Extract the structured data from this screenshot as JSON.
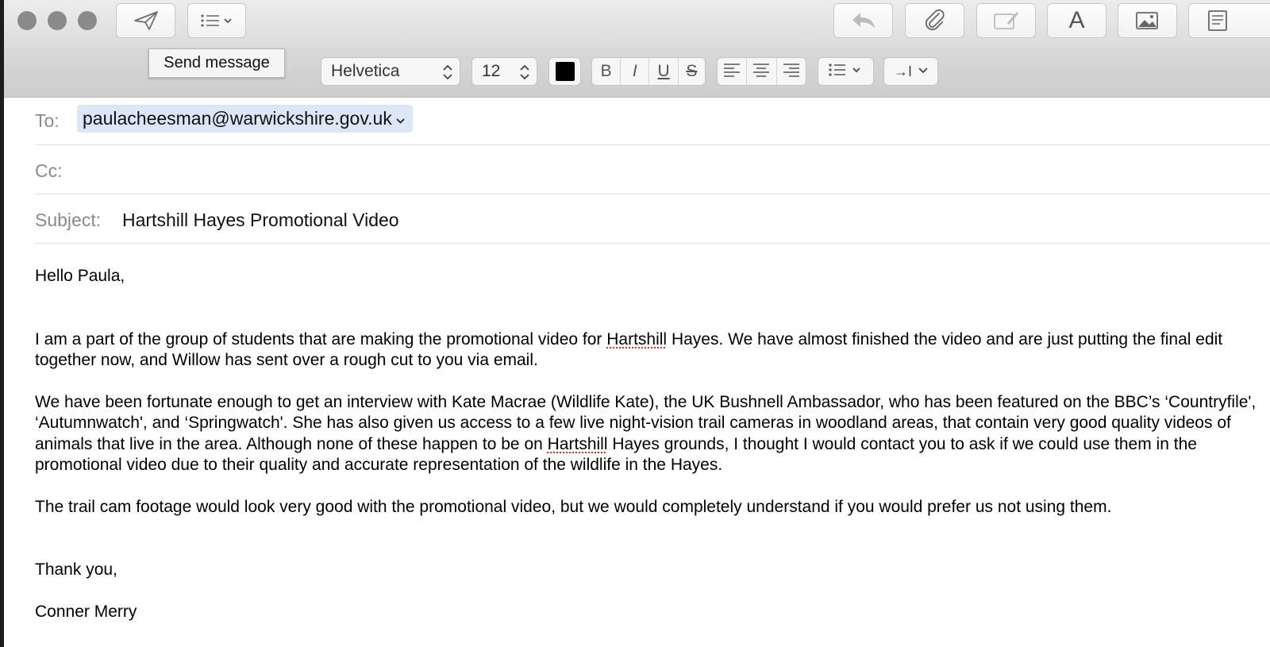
{
  "window": {
    "traffic_lights": [
      "close",
      "minimize",
      "zoom"
    ]
  },
  "toolbar": {
    "send_icon": "paper-plane-icon",
    "header_fields_icon": "list-chevron-icon",
    "reply_icon": "reply-arrow-icon",
    "attach_icon": "paperclip-icon",
    "annotate_icon": "markup-icon",
    "format_icon": "format-text-icon",
    "photo_icon": "photo-browser-icon",
    "stationery_icon": "stationery-icon",
    "format_glyph": "A"
  },
  "tooltip": {
    "text": "Send message"
  },
  "formatbar": {
    "font_family": "Helvetica",
    "font_size": "12",
    "text_color": "#000000",
    "bold": "B",
    "italic": "I",
    "underline": "U",
    "strike": "S",
    "align_icons": [
      "align-left-icon",
      "align-center-icon",
      "align-right-icon"
    ],
    "list_icon": "bullet-list-icon",
    "indent_glyph": "→I"
  },
  "headers": {
    "to_label": "To:",
    "to_value": "paulacheesman@warwickshire.gov.uk",
    "cc_label": "Cc:",
    "subject_label": "Subject:",
    "subject_value": "Hartshill Hayes Promotional Video"
  },
  "body": {
    "greeting": "Hello Paula,",
    "p1_a": "I am a part of the group of students that are making the promotional video for ",
    "p1_word": "Hartshill",
    "p1_b": " Hayes. We have almost finished the video and are just putting the final edit together now, and Willow has sent over a rough cut to you via email.",
    "p2_a": "We have been fortunate enough to get an interview with Kate Macrae (Wildlife Kate), the UK Bushnell Ambassador, who has been featured on the BBC’s ‘Countryfile', ‘Autumnwatch', and ‘Springwatch'. She has also given us access to a few live night-vision trail cameras in woodland areas, that contain very good quality videos of animals that live in the area. Although none of these happen to be on ",
    "p2_word": "Hartshill",
    "p2_b": " Hayes grounds, I thought I would contact you to ask if we could use them in the promotional video due to their quality and accurate representation of the wildlife in the Hayes.",
    "p3": "The trail cam footage would look very good with the promotional video, but we would completely understand if you would prefer us not using them.",
    "signoff": "Thank you,",
    "signature": "Conner Merry"
  }
}
